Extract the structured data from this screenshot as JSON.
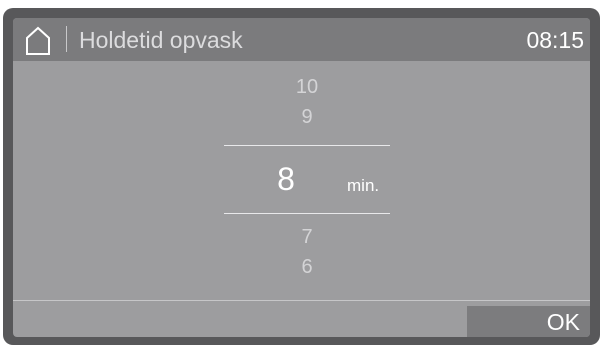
{
  "header": {
    "title": "Holdetid opvask",
    "clock": "08:15",
    "home_icon": "home-icon"
  },
  "roller": {
    "values_above": [
      "10",
      "9"
    ],
    "selected_value": "8",
    "unit": "min.",
    "values_below": [
      "7",
      "6"
    ]
  },
  "footer": {
    "ok_label": "OK"
  },
  "colors": {
    "frame": "#58585a",
    "screen": "#9d9d9f",
    "header": "#7b7b7d",
    "button": "#7c7c7e",
    "text_bright": "#ffffff",
    "text_dim": "#d4d4d6"
  }
}
